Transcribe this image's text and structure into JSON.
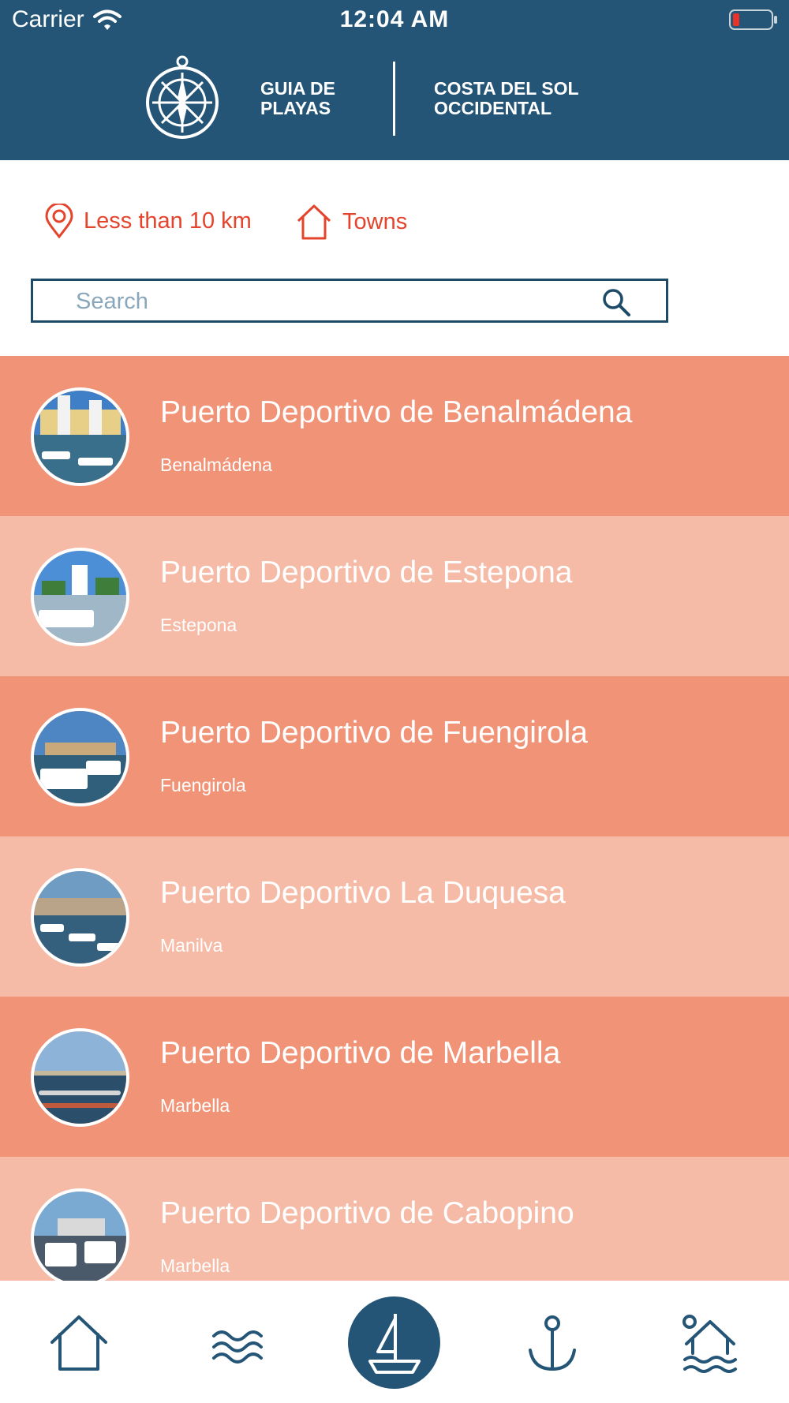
{
  "status_bar": {
    "carrier": "Carrier",
    "time": "12:04 AM"
  },
  "header": {
    "title_left": "GUIA DE\nPLAYAS",
    "title_right": "COSTA DEL SOL\nOCCIDENTAL"
  },
  "filters": {
    "distance_label": "Less than 10 km",
    "towns_label": "Towns"
  },
  "search": {
    "placeholder": "Search",
    "value": ""
  },
  "ports": [
    {
      "name": "Puerto Deportivo de Benalmádena",
      "town": "Benalmádena"
    },
    {
      "name": "Puerto Deportivo de Estepona",
      "town": "Estepona"
    },
    {
      "name": "Puerto Deportivo de Fuengirola",
      "town": "Fuengirola"
    },
    {
      "name": "Puerto Deportivo La Duquesa",
      "town": "Manilva"
    },
    {
      "name": "Puerto Deportivo de Marbella",
      "town": "Marbella"
    },
    {
      "name": "Puerto Deportivo de Cabopino",
      "town": "Marbella"
    }
  ],
  "tabs": [
    {
      "icon": "home-icon",
      "active": false
    },
    {
      "icon": "waves-icon",
      "active": false
    },
    {
      "icon": "sailboat-icon",
      "active": true
    },
    {
      "icon": "anchor-icon",
      "active": false
    },
    {
      "icon": "beach-town-icon",
      "active": false
    }
  ],
  "colors": {
    "header_bg": "#255576",
    "accent_red": "#e4442c",
    "row_dark": "#f09377",
    "row_light": "#f5bba7",
    "tab_icon": "#255576"
  }
}
